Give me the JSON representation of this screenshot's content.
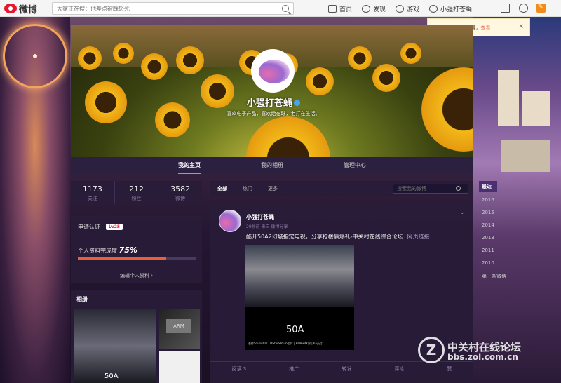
{
  "topbar": {
    "logo_text": "微博",
    "search_placeholder": "大家正在搜：他差点被踩怒死",
    "nav": [
      {
        "label": "首页",
        "icon": "home-icon"
      },
      {
        "label": "发现",
        "icon": "compass-icon"
      },
      {
        "label": "游戏",
        "icon": "gamepad-icon"
      },
      {
        "label": "小强打苍蝇",
        "icon": "user-icon"
      }
    ],
    "right_icons": [
      "mail-icon",
      "gear-icon",
      "edit-icon"
    ]
  },
  "notification": {
    "text": "1条新的好友圈微博，",
    "link": "查看",
    "close": "×"
  },
  "profile": {
    "name": "小强打苍蝇",
    "description": "喜欢电子产品，喜欢炝在球，老打在生活。",
    "verified": true
  },
  "tabs": [
    {
      "label": "我的主页",
      "active": true
    },
    {
      "label": "我的相册",
      "active": false
    },
    {
      "label": "管理中心",
      "active": false
    }
  ],
  "stats": [
    {
      "value": "1173",
      "label": "关注"
    },
    {
      "value": "212",
      "label": "粉丝"
    },
    {
      "value": "3582",
      "label": "微博"
    }
  ],
  "cert": {
    "label": "申请认证",
    "level": "Lv25",
    "progress_label": "个人资料完成度",
    "progress_value": "75%",
    "progress_fraction": 0.75,
    "edit_link": "编辑个人资料 ›"
  },
  "album": {
    "title": "相册",
    "photo1_caption": "50A",
    "photo2_caption": "ARM"
  },
  "feed": {
    "tabs": [
      {
        "label": "全部",
        "active": true
      },
      {
        "label": "热门",
        "active": false
      },
      {
        "label": "更多",
        "active": false
      }
    ],
    "search_placeholder": "搜索我的微博"
  },
  "post": {
    "author": "小强打苍蝇",
    "meta": "29秒前 来自 微博分享",
    "text": "酷开50A2幻城指定电视，分享抢楼赢爆礼-中关村在线综合论坛",
    "link_text": "网页链接",
    "image_caption": "50A",
    "image_small": "合作Soundbar | MStarSAS26芯片 | HDR+4K屏 | 65英寸",
    "actions": [
      "阅读 3",
      "推广",
      "转发",
      "评论",
      "赞"
    ]
  },
  "years": {
    "header": "最近",
    "items": [
      "2016",
      "2015",
      "2014",
      "2013",
      "2011",
      "2010",
      "第一条微博"
    ]
  },
  "watermark": {
    "line1": "中关村在线论坛",
    "line2": "bbs.zol.com.cn",
    "logo": "Z"
  },
  "colors": {
    "accent": "#f38a1a",
    "brand": "#e6162d",
    "panel": "#281c38"
  }
}
